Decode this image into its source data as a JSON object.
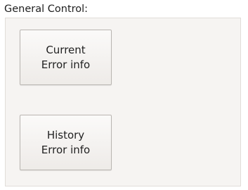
{
  "group": {
    "title": "General Control:"
  },
  "buttons": {
    "current_error": {
      "line1": "Current",
      "line2": "Error info"
    },
    "history_error": {
      "line1": "History",
      "line2": "Error info"
    }
  }
}
